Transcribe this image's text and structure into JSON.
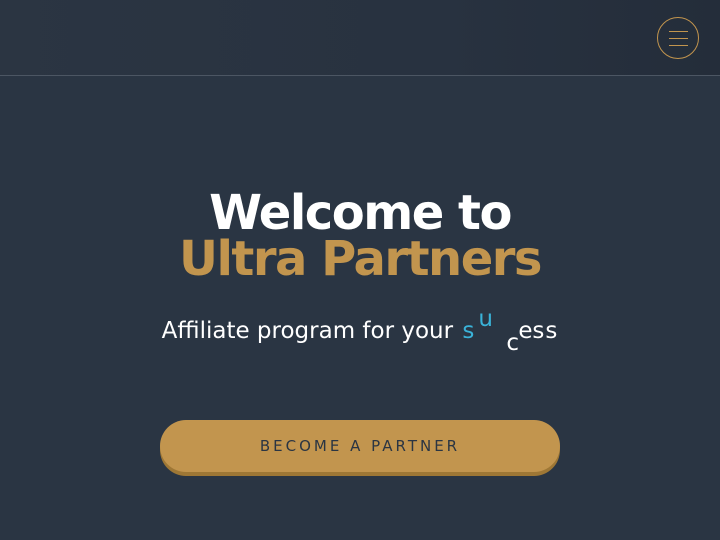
{
  "header": {
    "menu_icon": "hamburger-menu-icon"
  },
  "hero": {
    "title_line1": "Welcome to",
    "title_line2": "Ultra Partners",
    "subtitle_prefix": "Affiliate program for your",
    "subtitle_animated_letters": [
      "s",
      "u",
      "c",
      "e",
      "s",
      "s"
    ],
    "cta_label": "BECOME A PARTNER"
  },
  "colors": {
    "background": "#2a3543",
    "accent_gold": "#c2954e",
    "accent_blue": "#3ab3d9",
    "text_white": "#ffffff"
  }
}
